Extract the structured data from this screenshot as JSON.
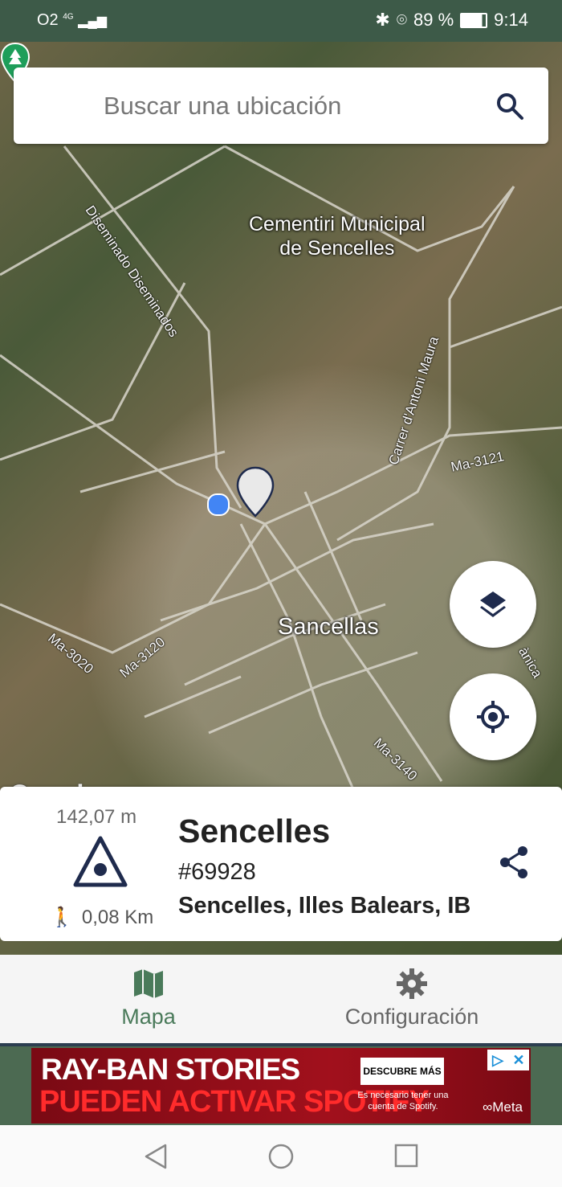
{
  "status_bar": {
    "carrier": "O2",
    "network": "4G",
    "battery": "89 %",
    "time": "9:14"
  },
  "search": {
    "placeholder": "Buscar una ubicación",
    "icon": "search-icon"
  },
  "map": {
    "poi_name": "Cementiri Municipal\nde Sencelles",
    "town_label": "Sancellas",
    "road_labels": [
      "Diseminado Diseminados",
      "Carrer d'Antoni Maura",
      "Ma-3121",
      "Ma-3020",
      "Ma-3120",
      "Ma-3140",
      "ànica"
    ],
    "attribution": "Google"
  },
  "fabs": {
    "layers": "layers-icon",
    "my_location": "my-location-icon"
  },
  "card": {
    "elevation": "142,07 m",
    "distance": "0,08 Km",
    "title": "Sencelles",
    "id": "#69928",
    "address": "Sencelles, Illes Balears, IB"
  },
  "bottom_nav": [
    {
      "label": "Mapa",
      "icon": "map-icon",
      "active": true,
      "color": "#4a7a5a"
    },
    {
      "label": "Configuración",
      "icon": "gear-icon",
      "active": false,
      "color": "#666666"
    }
  ],
  "ad": {
    "line1": "RAY-BAN STORIES",
    "line2": "PUEDEN ACTIVAR SPOTIFY",
    "cta": "DESCUBRE MÁS",
    "note": "Es necesario tener una cuenta de Spotify.",
    "brand": "∞Meta"
  },
  "colors": {
    "status_bg": "#3d5a48",
    "accent": "#4a7a5a",
    "triangle": "#1f2b4d",
    "location_dot": "#4285f4"
  }
}
